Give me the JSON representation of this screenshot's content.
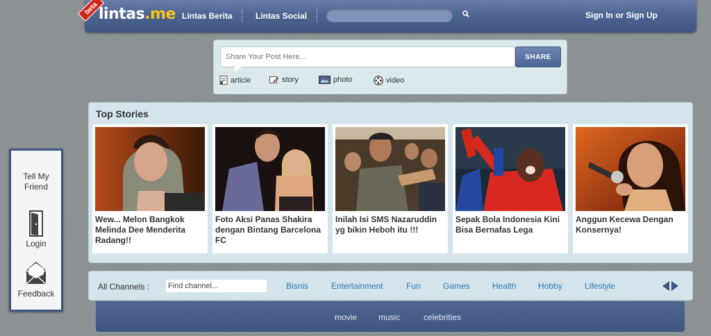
{
  "header": {
    "badge": "beta",
    "logo_main": "lintas",
    "logo_dot": ".",
    "logo_suffix": "me",
    "nav": [
      "Lintas Berita",
      "Lintas Social"
    ],
    "auth_link": "Sign In or Sign Up",
    "search_icon": "search-icon"
  },
  "share": {
    "placeholder": "Share Your Post Here...",
    "button": "SHARE",
    "types": [
      {
        "label": "article",
        "icon": "article-icon"
      },
      {
        "label": "story",
        "icon": "story-icon"
      },
      {
        "label": "photo",
        "icon": "photo-icon"
      },
      {
        "label": "video",
        "icon": "video-icon"
      }
    ]
  },
  "sidebar": {
    "tell_friend": "Tell My Friend",
    "login": "Login",
    "feedback": "Feedback"
  },
  "stories": {
    "title": "Top Stories",
    "items": [
      {
        "caption": "Wew... Melon Bangkok Melinda Dee Menderita Radang!!"
      },
      {
        "caption": "Foto Aksi Panas Shakira dengan Bintang Barcelona FC"
      },
      {
        "caption": "Inilah Isi SMS Nazaruddin yg bikin Heboh itu !!!"
      },
      {
        "caption": "Sepak Bola Indonesia Kini Bisa Bernafas Lega"
      },
      {
        "caption": "Anggun Kecewa Dengan Konsernya!"
      }
    ]
  },
  "channels": {
    "label": "All Channels :",
    "search_value": "Find channel...",
    "links": [
      "Bisnis",
      "Entertainment",
      "Fun",
      "Games",
      "Health",
      "Hobby",
      "Lifestyle"
    ],
    "sub_links": [
      "movie",
      "music",
      "celebrities"
    ]
  },
  "colors": {
    "nav_blue": "#4e6592",
    "logo_accent": "#f3c220",
    "panel_bg": "#d3e4ea",
    "link_blue": "#2f7ab3"
  }
}
